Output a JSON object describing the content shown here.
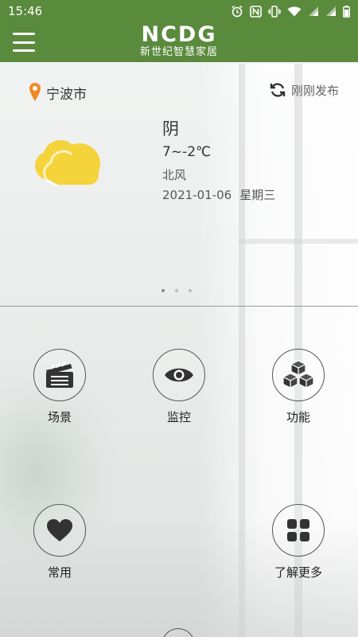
{
  "status_bar": {
    "time": "15:46",
    "icons": [
      "alarm-icon",
      "nfc-icon",
      "vibrate-icon",
      "wifi-icon",
      "signal-icon",
      "signal-icon-2",
      "battery-icon"
    ]
  },
  "app_bar": {
    "brand": "NCDG",
    "brand_sub": "新世纪智慧家居",
    "menu_icon": "hamburger-menu-icon",
    "color": "#5a8a3c"
  },
  "weather": {
    "location": "宁波市",
    "refresh_label": "刚刚发布",
    "condition": "阴",
    "temperature": "7~-2℃",
    "wind": "北风",
    "date": "2021-01-06",
    "weekday": "星期三",
    "icon": "cloudy-icon",
    "pager": {
      "pages": 3,
      "active": 1
    }
  },
  "menu": {
    "scene": {
      "label": "场景",
      "icon": "clapperboard-icon"
    },
    "monitor": {
      "label": "监控",
      "icon": "eye-icon"
    },
    "function": {
      "label": "功能",
      "icon": "cubes-icon"
    },
    "common": {
      "label": "常用",
      "icon": "heart-icon"
    },
    "more": {
      "label": "了解更多",
      "icon": "grid-icon"
    }
  },
  "colors": {
    "accent": "#5a8a3c",
    "location_pin": "#f08a24",
    "cloud": "#f5d33a"
  }
}
